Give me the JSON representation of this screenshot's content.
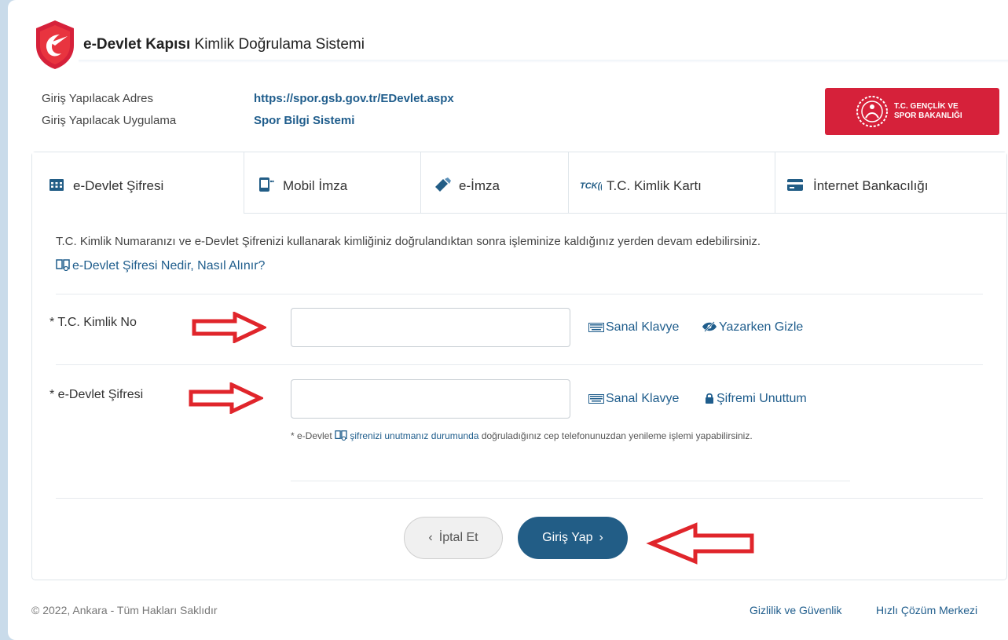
{
  "header": {
    "brand_bold": "e-Devlet Kapısı",
    "brand_rest": "Kimlik Doğrulama Sistemi"
  },
  "info": {
    "address_label": "Giriş Yapılacak Adres",
    "address_value": "https://spor.gsb.gov.tr/EDevlet.aspx",
    "app_label": "Giriş Yapılacak Uygulama",
    "app_value": "Spor Bilgi Sistemi"
  },
  "ministry": {
    "line1": "T.C. GENÇLİK VE",
    "line2": "SPOR BAKANLIĞI",
    "color": "#d6213a"
  },
  "tabs": [
    {
      "label": "e-Devlet Şifresi",
      "icon": "calendar-grid-icon",
      "active": true
    },
    {
      "label": "Mobil İmza",
      "icon": "mobile-phone-icon",
      "active": false
    },
    {
      "label": "e-İmza",
      "icon": "usb-token-icon",
      "active": false
    },
    {
      "label": "T.C. Kimlik Kartı",
      "icon": "id-card-logo-icon",
      "active": false
    },
    {
      "label": "İnternet Bankacılığı",
      "icon": "credit-card-icon",
      "active": false
    }
  ],
  "form": {
    "description": "T.C. Kimlik Numaranızı ve e-Devlet Şifrenizi kullanarak kimliğiniz doğrulandıktan sonra işleminize kaldığınız yerden devam edebilirsiniz.",
    "help_link": "e-Devlet Şifresi Nedir, Nasıl Alınır?",
    "tc_label": "* T.C. Kimlik No",
    "tc_value": "",
    "password_label": "* e-Devlet Şifresi",
    "password_value": "",
    "virtual_keyboard": "Sanal Klavye",
    "hide_while_typing": "Yazarken Gizle",
    "forgot_password": "Şifremi Unuttum",
    "note_prefix": "* e-Devlet",
    "note_emph": "şifrenizi unutmanız durumunda",
    "note_rest": "doğruladığınız cep telefonunuzdan yenileme işlemi yapabilirsiniz.",
    "cancel_label": "İptal Et",
    "login_label": "Giriş Yap"
  },
  "footer": {
    "copyright": "© 2022, Ankara - Tüm Hakları Saklıdır",
    "privacy": "Gizlilik ve Güvenlik",
    "help_center": "Hızlı Çözüm Merkezi"
  },
  "colors": {
    "accent": "#225d86",
    "link": "#1f5d8c",
    "annotation_arrow": "#e0252b"
  }
}
